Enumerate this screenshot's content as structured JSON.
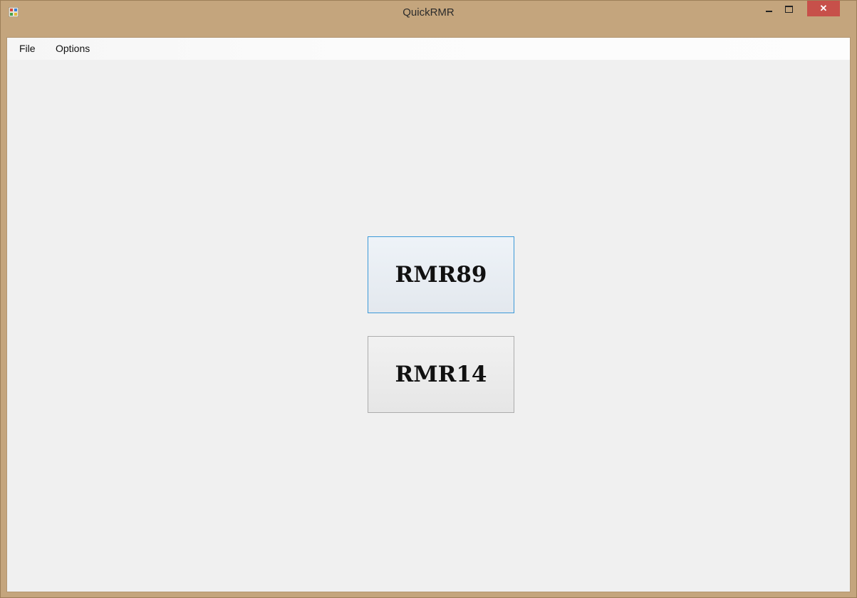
{
  "window": {
    "title": "QuickRMR",
    "close_glyph": "✕",
    "app_icon": "app-icon",
    "colors": {
      "frame": "#c4a57d",
      "close_button": "#c7504a",
      "client_bg": "#f0f0f0",
      "focus_border": "#3c99d8"
    }
  },
  "menubar": {
    "items": [
      {
        "label": "File"
      },
      {
        "label": "Options"
      }
    ]
  },
  "main": {
    "buttons": [
      {
        "label": "RMR89",
        "focused": true
      },
      {
        "label": "RMR14",
        "focused": false
      }
    ]
  }
}
